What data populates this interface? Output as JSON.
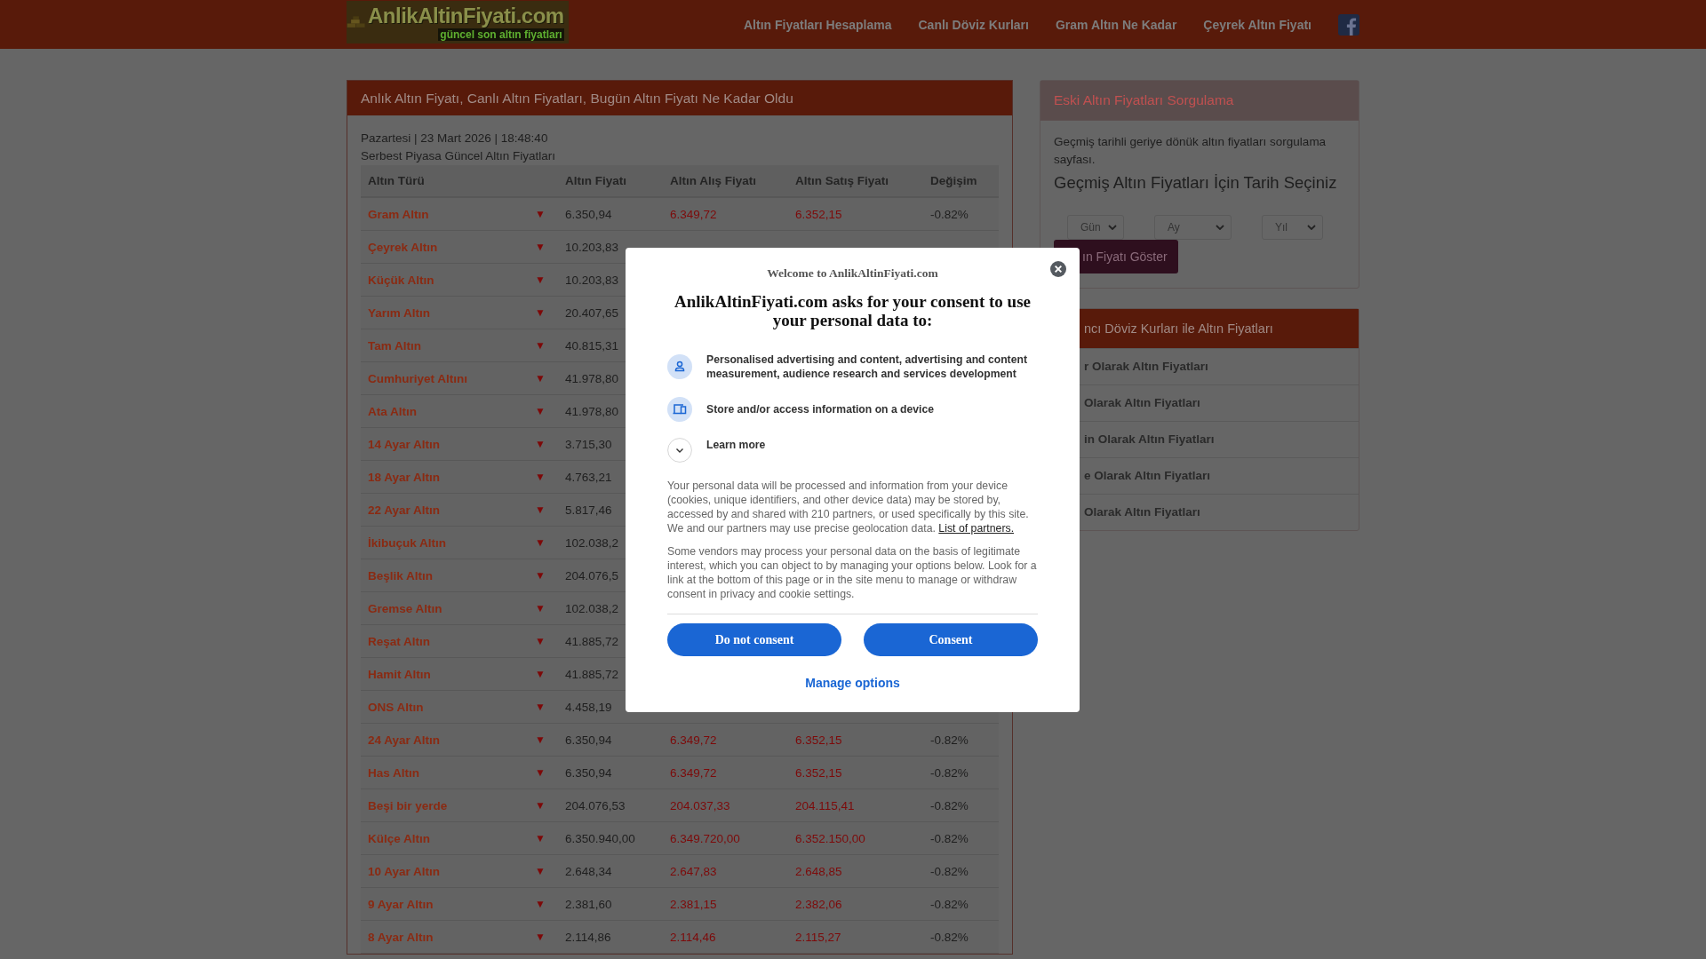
{
  "header": {
    "logo_title": "AnlikAltinFiyati.com",
    "logo_subtitle": "güncel son altın fiyatları",
    "nav": [
      "Altın Fiyatları Hesaplama",
      "Canlı Döviz Kurları",
      "Gram Altın Ne Kadar",
      "Çeyrek Altın Fiyatı"
    ]
  },
  "main_panel": {
    "title": "Anlık Altın Fiyatı, Canlı Altın Fiyatları, Bugün Altın Fiyatı Ne Kadar Oldu",
    "date": "Pazartesi | 23 Mart 2026 | 18:48:40",
    "subtitle": "Serbest Piyasa Güncel Altın Fiyatları",
    "columns": [
      "Altın Türü",
      "Altın Fiyatı",
      "Altın Alış Fiyatı",
      "Altın Satış Fiyatı",
      "Değişim"
    ],
    "rows": [
      {
        "name": "Gram Altın",
        "arrow": "▼",
        "price": "6.350,94",
        "buy": "6.349,72",
        "sell": "6.352,15",
        "change": "-0.82%"
      },
      {
        "name": "Çeyrek Altın",
        "arrow": "▼",
        "price": "10.203,83"
      },
      {
        "name": "Küçük Altın",
        "arrow": "▼",
        "price": "10.203,83"
      },
      {
        "name": "Yarım Altın",
        "arrow": "▼",
        "price": "20.407,65"
      },
      {
        "name": "Tam Altın",
        "arrow": "▼",
        "price": "40.815,31"
      },
      {
        "name": "Cumhuriyet Altını",
        "arrow": "▼",
        "price": "41.978,80"
      },
      {
        "name": "Ata Altın",
        "arrow": "▼",
        "price": "41.978,80"
      },
      {
        "name": "14 Ayar Altın",
        "arrow": "▼",
        "price": "3.715,30"
      },
      {
        "name": "18 Ayar Altın",
        "arrow": "▼",
        "price": "4.763,21"
      },
      {
        "name": "22 Ayar Altın",
        "arrow": "▼",
        "price": "5.817,46"
      },
      {
        "name": "İkibuçuk Altın",
        "arrow": "▼",
        "price": "102.038,2"
      },
      {
        "name": "Beşlik Altın",
        "arrow": "▼",
        "price": "204.076,5"
      },
      {
        "name": "Gremse Altın",
        "arrow": "▼",
        "price": "102.038,2"
      },
      {
        "name": "Reşat Altın",
        "arrow": "▼",
        "price": "41.885,72"
      },
      {
        "name": "Hamit Altın",
        "arrow": "▼",
        "price": "41.885,72"
      },
      {
        "name": "ONS Altın",
        "arrow": "▼",
        "price": "4.458,19"
      },
      {
        "name": "24 Ayar Altın",
        "arrow": "▼",
        "price": "6.350,94",
        "buy": "6.349,72",
        "sell": "6.352,15",
        "change": "-0.82%"
      },
      {
        "name": "Has Altın",
        "arrow": "▼",
        "price": "6.350,94",
        "buy": "6.349,72",
        "sell": "6.352,15",
        "change": "-0.82%"
      },
      {
        "name": "Beşi bir yerde",
        "arrow": "▼",
        "price": "204.076,53",
        "buy": "204.037,33",
        "sell": "204.115,41",
        "change": "-0.82%"
      },
      {
        "name": "Külçe Altın",
        "arrow": "▼",
        "price": "6.350.940,00",
        "buy": "6.349.720,00",
        "sell": "6.352.150,00",
        "change": "-0.82%"
      },
      {
        "name": "10 Ayar Altın",
        "arrow": "▼",
        "price": "2.648,34",
        "buy": "2.647,83",
        "sell": "2.648,85",
        "change": "-0.82%"
      },
      {
        "name": "9 Ayar Altın",
        "arrow": "▼",
        "price": "2.381,60",
        "buy": "2.381,15",
        "sell": "2.382,06",
        "change": "-0.82%"
      },
      {
        "name": "8 Ayar Altın",
        "arrow": "▼",
        "price": "2.114,86",
        "buy": "2.114,46",
        "sell": "2.115,27",
        "change": "-0.82%"
      }
    ]
  },
  "sidebar": {
    "query_title": "Eski Altın Fiyatları Sorgulama",
    "description": "Geçmiş tarihli geriye dönük altın fiyatları sorgulama sayfası.",
    "heading": "Geçmiş Altın Fiyatları İçin Tarih Seçiniz",
    "selects": [
      "Gün",
      "Ay",
      "Yıl"
    ],
    "show_button": "ın Fiyatı Göster",
    "currency_title": "ncı Döviz Kurları ile Altın Fiyatları",
    "currency_items": [
      "r Olarak Altın Fiyatları",
      "Olarak Altın Fiyatları",
      "in Olarak Altın Fiyatları",
      "e Olarak Altın Fiyatları",
      "Olarak Altın Fiyatları"
    ]
  },
  "consent": {
    "welcome": "Welcome to AnlikAltinFiyati.com",
    "heading": "AnlikAltinFiyati.com asks for your consent to use your personal data to:",
    "purposes": [
      {
        "kind": "person",
        "text": "Personalised advertising and content, advertising and content measurement, audience research and services development"
      },
      {
        "kind": "device",
        "text": "Store and/or access information on a device"
      },
      {
        "kind": "expand",
        "text": "Learn more"
      }
    ],
    "paragraph_1": "Your personal data will be processed and information from your device (cookies, unique identifiers, and other device data) may be stored by, accessed by and shared with 210 partners, or used specifically by this site. We and our partners may use precise geolocation data.",
    "partners_link": "List of partners.",
    "paragraph_2": "Some vendors may process your personal data on the basis of legitimate interest, which you can object to by managing your options below. Look for a link at the bottom of this page or in the site menu to manage or withdraw consent in privacy and cookie settings.",
    "buttons": [
      "Do not consent",
      "Consent"
    ],
    "manage": "Manage options"
  }
}
